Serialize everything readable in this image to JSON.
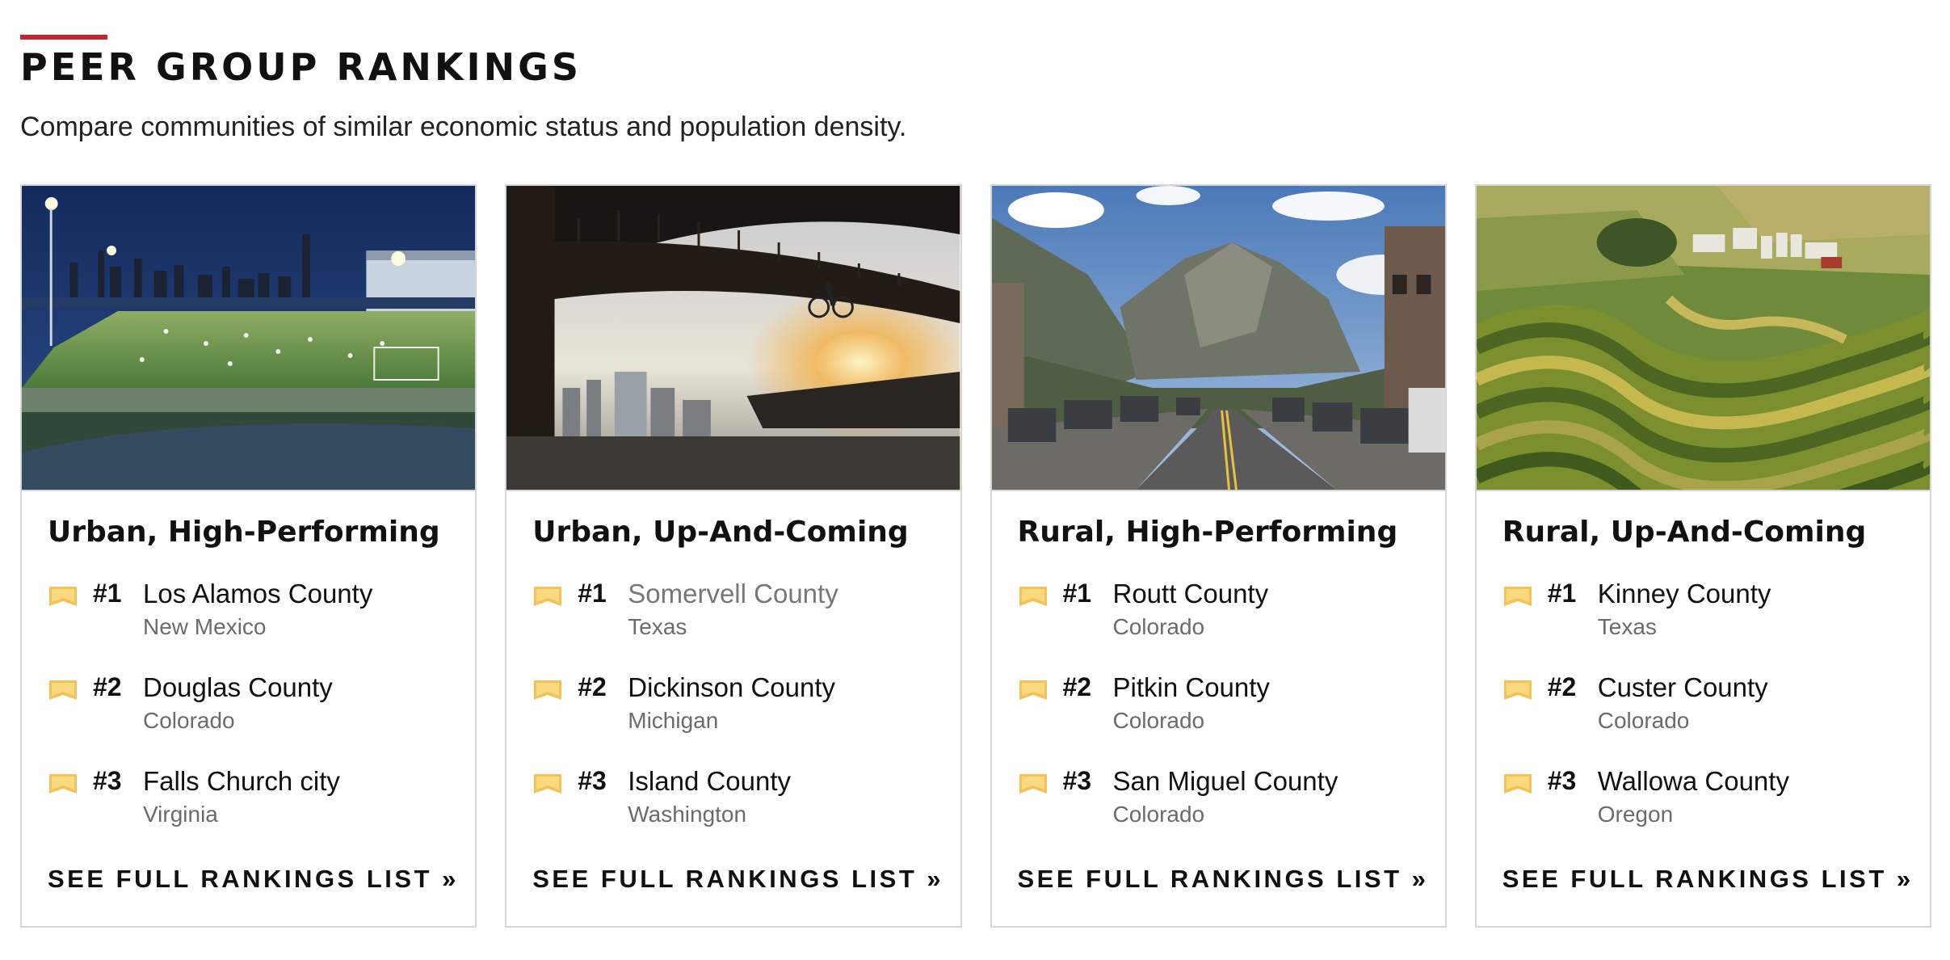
{
  "header": {
    "title": "PEER GROUP RANKINGS",
    "subtitle": "Compare communities of similar economic status and population density.",
    "accent_color": "#c8242b"
  },
  "cards": [
    {
      "title": "Urban, High-Performing",
      "image": "urban-night-soccer-field-skyline",
      "link_label": "SEE FULL RANKINGS LIST »",
      "rankings": [
        {
          "rank": "#1",
          "county": "Los Alamos County",
          "state": "New Mexico"
        },
        {
          "rank": "#2",
          "county": "Douglas County",
          "state": "Colorado"
        },
        {
          "rank": "#3",
          "county": "Falls Church city",
          "state": "Virginia"
        }
      ]
    },
    {
      "title": "Urban, Up-And-Coming",
      "image": "cyclist-on-bridge-sunset",
      "link_label": "SEE FULL RANKINGS LIST »",
      "rankings": [
        {
          "rank": "#1",
          "county": "Somervell County",
          "state": "Texas"
        },
        {
          "rank": "#2",
          "county": "Dickinson County",
          "state": "Michigan"
        },
        {
          "rank": "#3",
          "county": "Island County",
          "state": "Washington"
        }
      ]
    },
    {
      "title": "Rural, High-Performing",
      "image": "mountain-town-main-street",
      "link_label": "SEE FULL RANKINGS LIST »",
      "rankings": [
        {
          "rank": "#1",
          "county": "Routt County",
          "state": "Colorado"
        },
        {
          "rank": "#2",
          "county": "Pitkin County",
          "state": "Colorado"
        },
        {
          "rank": "#3",
          "county": "San Miguel County",
          "state": "Colorado"
        }
      ]
    },
    {
      "title": "Rural, Up-And-Coming",
      "image": "aerial-farm-contour-fields",
      "link_label": "SEE FULL RANKINGS LIST »",
      "rankings": [
        {
          "rank": "#1",
          "county": "Kinney County",
          "state": "Texas"
        },
        {
          "rank": "#2",
          "county": "Custer County",
          "state": "Colorado"
        },
        {
          "rank": "#3",
          "county": "Wallowa County",
          "state": "Oregon"
        }
      ]
    }
  ]
}
